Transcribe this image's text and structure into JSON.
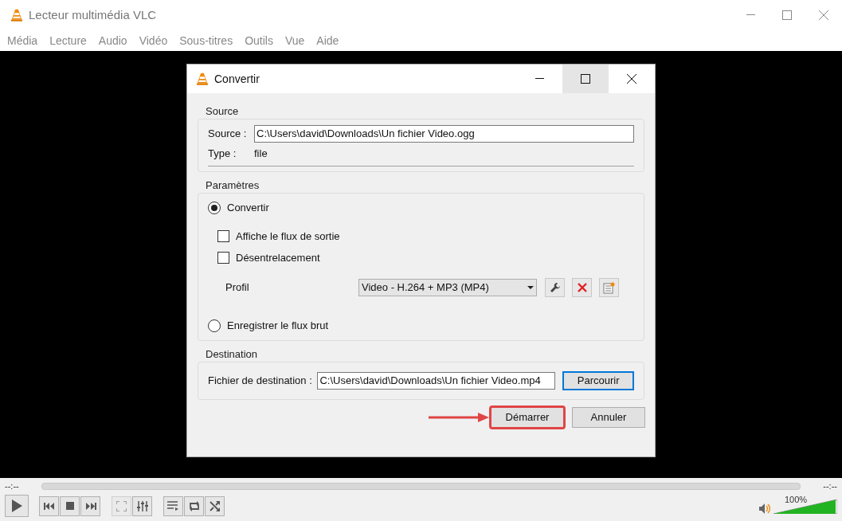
{
  "window": {
    "title": "Lecteur multimédia VLC"
  },
  "menu": [
    "Média",
    "Lecture",
    "Audio",
    "Vidéo",
    "Sous-titres",
    "Outils",
    "Vue",
    "Aide"
  ],
  "dialog": {
    "title": "Convertir",
    "source": {
      "title": "Source",
      "label": "Source :",
      "value": "C:\\Users\\david\\Downloads\\Un fichier Video.ogg",
      "type_label": "Type :",
      "type_value": "file"
    },
    "settings": {
      "title": "Paramètres",
      "modes": [
        {
          "label": "Convertir",
          "selected": true,
          "options": [
            {
              "label": "Affiche le flux de sortie",
              "checked": false
            },
            {
              "label": "Désentrelacement",
              "checked": false
            }
          ],
          "profile": {
            "label": "Profil",
            "value": "Video - H.264 + MP3 (MP4)"
          }
        },
        {
          "label": "Enregistrer le flux brut",
          "selected": false
        }
      ]
    },
    "destination": {
      "title": "Destination",
      "label": "Fichier de destination :",
      "value": "C:\\Users\\david\\Downloads\\Un fichier Video.mp4",
      "browse": "Parcourir"
    },
    "buttons": [
      {
        "label": "Démarrer",
        "highlighted": true
      },
      {
        "label": "Annuler",
        "highlighted": false
      }
    ]
  },
  "player": {
    "elapsed": "--:--",
    "remaining": "--:--",
    "volume_reading": "100%",
    "volume": {
      "level": 1.0
    }
  }
}
